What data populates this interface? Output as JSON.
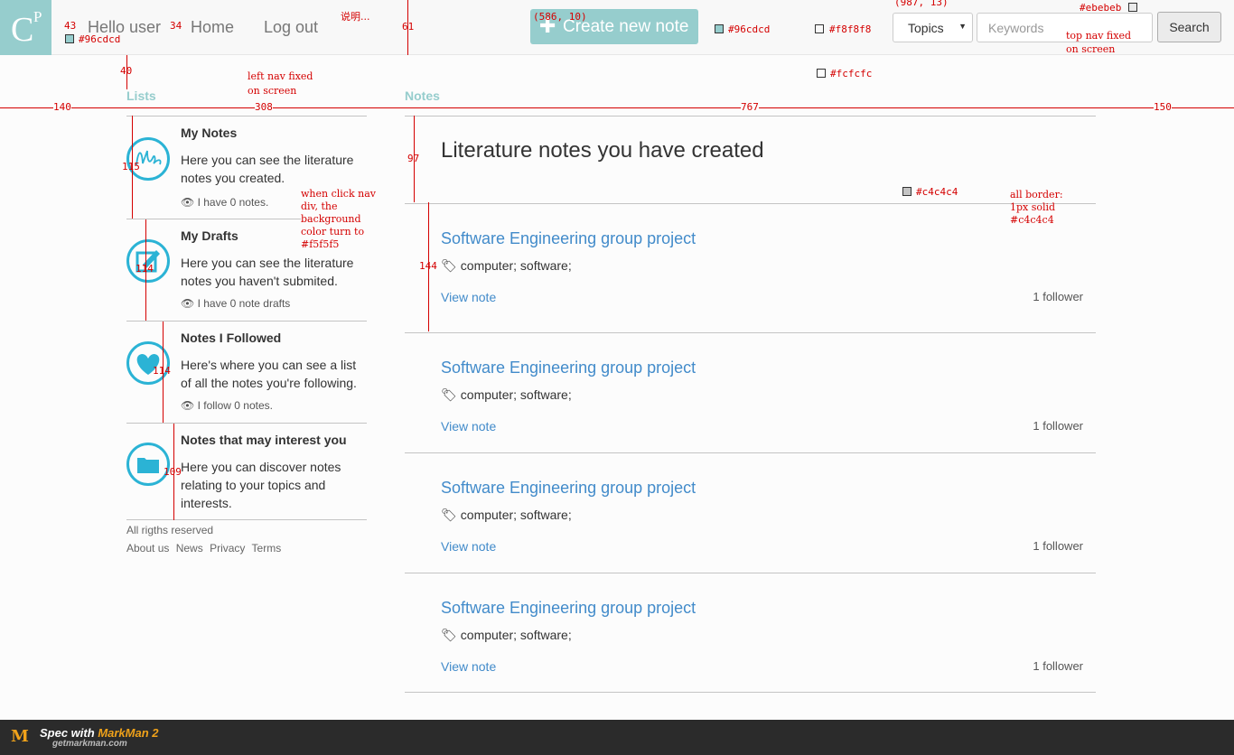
{
  "topnav": {
    "logo_c": "C",
    "logo_p": "P",
    "greeting": "Hello user",
    "home": "Home",
    "logout": "Log out",
    "create_label": "Create new note",
    "topics_label": "Topics",
    "keywords_placeholder": "Keywords",
    "search_label": "Search"
  },
  "headers": {
    "lists": "Lists",
    "notes": "Notes"
  },
  "leftnav": {
    "items": [
      {
        "title": "My Notes",
        "desc": "Here you can see the literature notes you created.",
        "count": "I have 0 notes."
      },
      {
        "title": "My Drafts",
        "desc": "Here you can see the literature notes you haven't submited.",
        "count": "I have 0 note drafts"
      },
      {
        "title": "Notes I Followed",
        "desc": "Here's where you can see a list of all the notes you're following.",
        "count": "I follow 0 notes."
      },
      {
        "title": "Notes that may interest you",
        "desc": "Here you can discover notes relating to your topics and interests."
      }
    ]
  },
  "footer": {
    "rights": "All rigths reserved",
    "links": [
      "About us",
      "News",
      "Privacy",
      "Terms"
    ]
  },
  "notes": {
    "heading": "Literature notes you have created",
    "items": [
      {
        "title": "Software Engineering group project",
        "tags": "computer; software;",
        "view": "View note",
        "followers": "1 follower"
      },
      {
        "title": "Software Engineering group project",
        "tags": "computer; software;",
        "view": "View note",
        "followers": "1 follower"
      },
      {
        "title": "Software Engineering group project",
        "tags": "computer; software;",
        "view": "View note",
        "followers": "1 follower"
      },
      {
        "title": "Software Engineering group project",
        "tags": "computer; software;",
        "view": "View note",
        "followers": "1 follower"
      }
    ]
  },
  "annotations": {
    "d43": "43",
    "d34": "34",
    "d61": "61",
    "d40": "40",
    "d140": "140",
    "d308": "308",
    "d767": "767",
    "d150": "150",
    "d97": "97",
    "d144": "144",
    "d115": "115",
    "d114a": "114",
    "d114b": "114",
    "d109": "109",
    "logo_color": "#96cdcd",
    "btn_color": "#96cdcd",
    "nav_bg": "#f8f8f8",
    "page_bg": "#fcfcfc",
    "search_color": "#ebebeb",
    "border_color": "#c4c4c4",
    "coord_btn": "(586, 10)",
    "coord_topics": "(987, 13)",
    "note_explain": "说明...",
    "note_leftnav_1": "left nav fixed",
    "note_leftnav_2": "on screen",
    "note_topnav_1": "top nav fixed",
    "note_topnav_2": "on screen",
    "note_click": "when click nav\ndiv, the\nbackground\ncolor turn to\n#f5f5f5",
    "note_border": "all border:\n1px solid\n#c4c4c4"
  },
  "markman": {
    "line1_a": "Spec with",
    "line1_b": "MarkMan 2",
    "line2": "getmarkman.com"
  },
  "colors": {
    "accent": "#96cdcd",
    "icon_blue": "#2bb3d5",
    "link": "#428bca",
    "border": "#c4c4c4"
  }
}
